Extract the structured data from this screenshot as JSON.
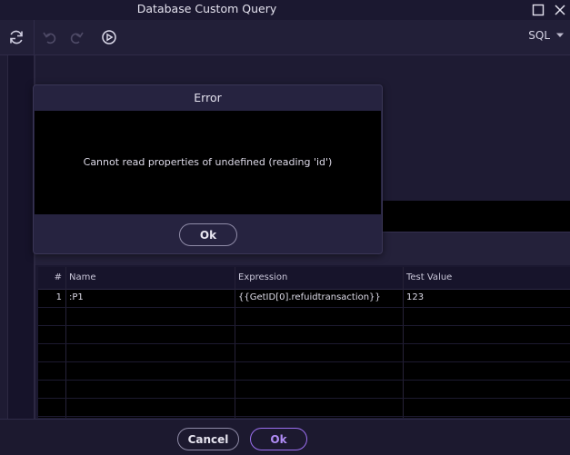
{
  "window": {
    "title": "Database Custom Query"
  },
  "toolbar": {
    "refresh_icon": "refresh-icon",
    "undo_icon": "undo-icon",
    "redo_icon": "redo-icon",
    "run_icon": "play-circle-icon",
    "language": "SQL"
  },
  "params_table": {
    "headers": {
      "num": "#",
      "name": "Name",
      "expression": "Expression",
      "test_value": "Test Value"
    },
    "rows": [
      {
        "num": "1",
        "name": ":P1",
        "expression": "{{GetID[0].refuidtransaction}}",
        "test_value": "123"
      }
    ]
  },
  "footer": {
    "cancel_label": "Cancel",
    "ok_label": "Ok"
  },
  "error_dialog": {
    "title": "Error",
    "message": "Cannot read properties of undefined (reading 'id')",
    "ok_label": "Ok"
  }
}
